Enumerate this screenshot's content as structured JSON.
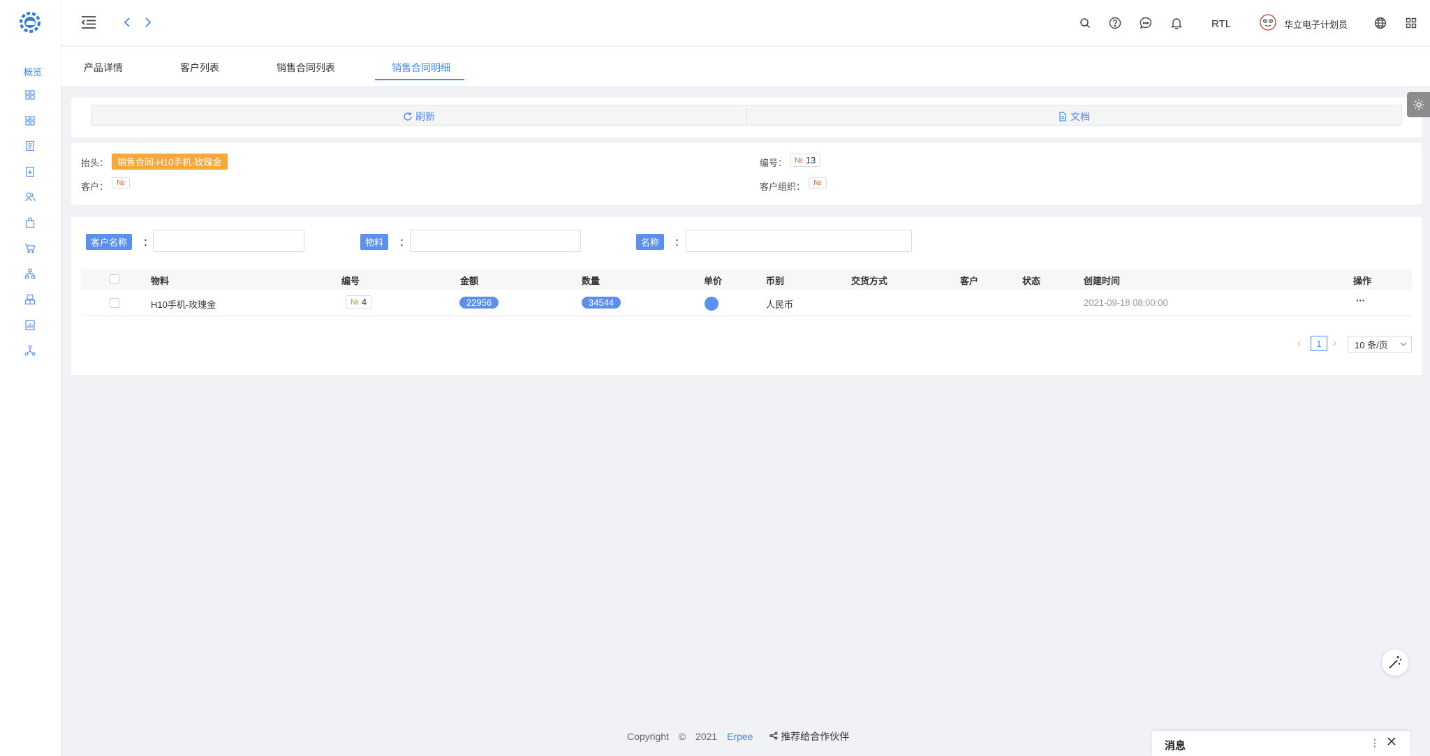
{
  "header": {
    "rtl_label": "RTL",
    "user_name": "华立电子计划员"
  },
  "sidebar": {
    "overview_label": "概览",
    "icons": [
      "grid-icon",
      "grid-icon",
      "document-icon",
      "download-icon",
      "users-icon",
      "bag-icon",
      "cart-icon",
      "org-icon",
      "building-icon",
      "report-icon",
      "share-icon"
    ]
  },
  "tabs": [
    {
      "label": "产品详情"
    },
    {
      "label": "客户列表"
    },
    {
      "label": "销售合同列表"
    },
    {
      "label": "销售合同明细",
      "active": true
    }
  ],
  "toolbar": {
    "refresh_label": "刷新",
    "docs_label": "文档"
  },
  "detail": {
    "title_label": "抬头：",
    "title_value": "销售合同-H10手机-玫瑰金",
    "code_label": "编号：",
    "code_value": "13",
    "customer_label": "客户：",
    "customer_org_label": "客户组织：",
    "no_sign": "№"
  },
  "filters": [
    {
      "label": "客户名称",
      "colon": "：",
      "value": ""
    },
    {
      "label": "物料",
      "colon": "：",
      "value": ""
    },
    {
      "label": "名称",
      "colon": "：",
      "value": ""
    }
  ],
  "table": {
    "columns": [
      "物料",
      "编号",
      "金额",
      "数量",
      "单价",
      "币别",
      "交货方式",
      "客户",
      "状态",
      "创建时间",
      "操作"
    ],
    "rows": [
      {
        "material": "H10手机-玫瑰金",
        "code": "4",
        "amount": "22956",
        "quantity": "34544",
        "currency": "人民币",
        "created": "2021-09-18 08:00:00",
        "actions": "···"
      }
    ]
  },
  "pagination": {
    "current": "1",
    "page_size": "10 条/页"
  },
  "footer": {
    "copyright": "Copyright",
    "year": "2021",
    "brand": "Erpee",
    "recommend": "推荐给合作伙伴"
  },
  "messages": {
    "title": "消息"
  },
  "colors": {
    "accent": "#4a8af4",
    "tag_orange": "#f7a83b"
  }
}
